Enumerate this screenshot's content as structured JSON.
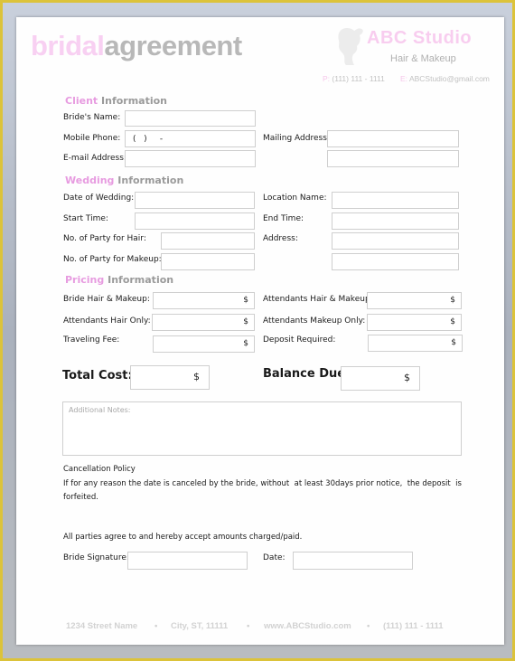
{
  "header": {
    "title_part1": "bridal",
    "title_part2": "agreement",
    "studio_name": "ABC Studio",
    "tagline": "Hair & Makeup",
    "phone_prefix": "P:",
    "phone": "(111) 111 - 1111",
    "email_prefix": "E:",
    "email": "ABCStudio@gmail.com"
  },
  "client": {
    "heading_accent": "Client",
    "heading_rest": "Information",
    "brides_name_label": "Bride's Name:",
    "brides_name_value": "",
    "mobile_label": "Mobile Phone:",
    "mobile_value": "(   )     -",
    "mailing_label": "Mailing Address:",
    "email_label": "E-mail Address:"
  },
  "wedding": {
    "heading_accent": "Wedding",
    "heading_rest": "Information",
    "date_label": "Date of Wedding:",
    "location_label": "Location Name:",
    "start_label": "Start Time:",
    "end_label": "End Time:",
    "party_hair_label": "No. of Party for Hair:",
    "address_label": "Address:",
    "party_makeup_label": "No. of Party for Makeup:"
  },
  "pricing": {
    "heading_accent": "Pricing",
    "heading_rest": "Information",
    "currency": "$",
    "bride_hm_label": "Bride Hair & Makeup:",
    "att_hm_label": "Attendants Hair & Makeup:",
    "att_hair_label": "Attendants Hair Only:",
    "att_makeup_label": "Attendants Makeup Only:",
    "travel_label": "Traveling Fee:",
    "deposit_label": "Deposit Required:",
    "total_label": "Total Cost:",
    "balance_label": "Balance Due:"
  },
  "notes": {
    "placeholder": "Additional Notes:"
  },
  "policy": {
    "heading": "Cancellation  Policy",
    "body_line1": "If for any reason the date is canceled by the bride, without  at least 30days prior notice,  the deposit  is",
    "body_line2": "forfeited.",
    "agreement": "All parties agree to and hereby accept amounts charged/paid.",
    "signature_label": "Bride Signature:",
    "date_label": "Date:"
  },
  "footer": {
    "street": "1234 Street Name",
    "city": "City, ST, 11111",
    "website": "www.ABCStudio.com",
    "phone": "(111) 111 - 1111",
    "separator": "•"
  }
}
